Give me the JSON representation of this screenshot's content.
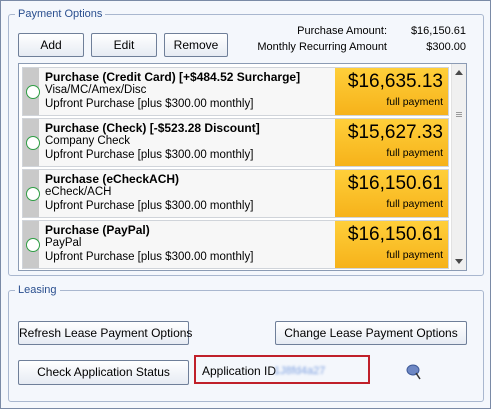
{
  "payment_options": {
    "legend": "Payment Options",
    "buttons": {
      "add": "Add",
      "edit": "Edit",
      "remove": "Remove"
    },
    "summary": {
      "purchase_amount_label": "Purchase Amount:",
      "purchase_amount_value": "$16,150.61",
      "monthly_recurring_label": "Monthly Recurring Amount",
      "monthly_recurring_value": "$300.00"
    },
    "options": [
      {
        "title": "Purchase (Credit Card) [+$484.52 Surcharge]",
        "method": "Visa/MC/Amex/Disc",
        "detail": "Upfront Purchase [plus $300.00 monthly]",
        "price": "$16,635.13",
        "price_note": "full payment"
      },
      {
        "title": "Purchase (Check) [-$523.28 Discount]",
        "method": "Company Check",
        "detail": "Upfront Purchase [plus $300.00 monthly]",
        "price": "$15,627.33",
        "price_note": "full payment"
      },
      {
        "title": "Purchase (eCheckACH)",
        "method": "eCheck/ACH",
        "detail": "Upfront Purchase [plus $300.00 monthly]",
        "price": "$16,150.61",
        "price_note": "full payment"
      },
      {
        "title": "Purchase (PayPal)",
        "method": "PayPal",
        "detail": "Upfront Purchase [plus $300.00 monthly]",
        "price": "$16,150.61",
        "price_note": "full payment"
      }
    ]
  },
  "leasing": {
    "legend": "Leasing",
    "refresh_button": "Refresh Lease Payment Options",
    "change_button": "Change Lease Payment Options",
    "check_status_button": "Check Application Status",
    "application_id_label": "Application ID",
    "application_id_value": "1J8fd4a27"
  },
  "colors": {
    "price_box": "#f6b21a",
    "radio_ring": "#2f9e44",
    "highlight_border": "#c0202a",
    "legend_text": "#2a4f8f"
  },
  "icons": {
    "status_icon": "pin-icon"
  }
}
